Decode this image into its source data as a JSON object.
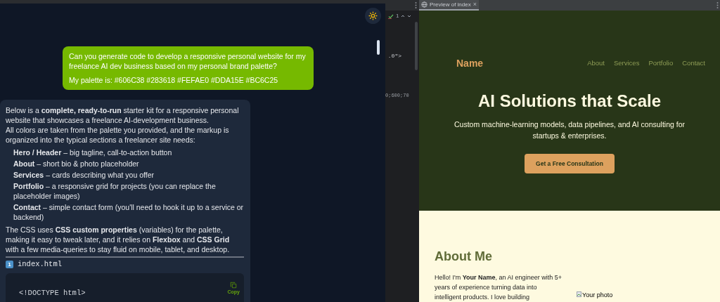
{
  "chat": {
    "user_message": {
      "lines": [
        "Can you generate code to develop a responsive personal website for my freelance AI dev business based on my personal brand palette?",
        "My palette is: #606C38 #283618 #FEFAE0 #DDA15E #BC6C25"
      ]
    },
    "answer": {
      "intro": "Below is a **complete, ready-to-run** starter kit for a responsive personal website that showcases a freelance AI-development business.",
      "intro2": "All colors are taken from the palette you provided, and the markup is organized into the typical sections a freelancer site needs:",
      "items": [
        "**Hero / Header** – big tagline, call-to-action button",
        "**About** – short bio & photo placeholder",
        "**Services** – cards describing what you offer",
        "**Portfolio** – a responsive grid for projects (you can replace the placeholder images)",
        "**Contact** – simple contact form (you'll need to hook it up to a service or backend)"
      ],
      "outro": "The CSS uses **CSS custom properties** (variables) for the palette, making it easy to tweak later, and it relies on **Flexbox** and **CSS Grid** with a few media-queries to stay fluid on mobile, tablet, and desktop.",
      "file_heading": {
        "number": "1",
        "label": "index.html"
      },
      "code_block": {
        "first_line": "<!DOCTYPE html>",
        "copy_label": "Copy"
      }
    }
  },
  "editor": {
    "problem_count": "1",
    "code_lines": [
      ".0\">",
      "0;600;70"
    ]
  },
  "preview": {
    "tab": {
      "label": "Preview of index",
      "selected": true,
      "close": "×"
    },
    "site": {
      "brand": "Name",
      "nav": [
        "About",
        "Services",
        "Portfolio",
        "Contact"
      ],
      "hero_title": "AI Solutions that Scale",
      "hero_subtitle": "Custom machine-learning models, data pipelines, and AI consulting for startups & enterprises.",
      "cta": "Get a Free Consultation",
      "about_title": "About Me",
      "about_text": "Hello! I'm **Your Name**, an AI engineer with 5+ years of experience turning data into intelligent products. I love building",
      "photo_alt": "Your photo"
    }
  }
}
